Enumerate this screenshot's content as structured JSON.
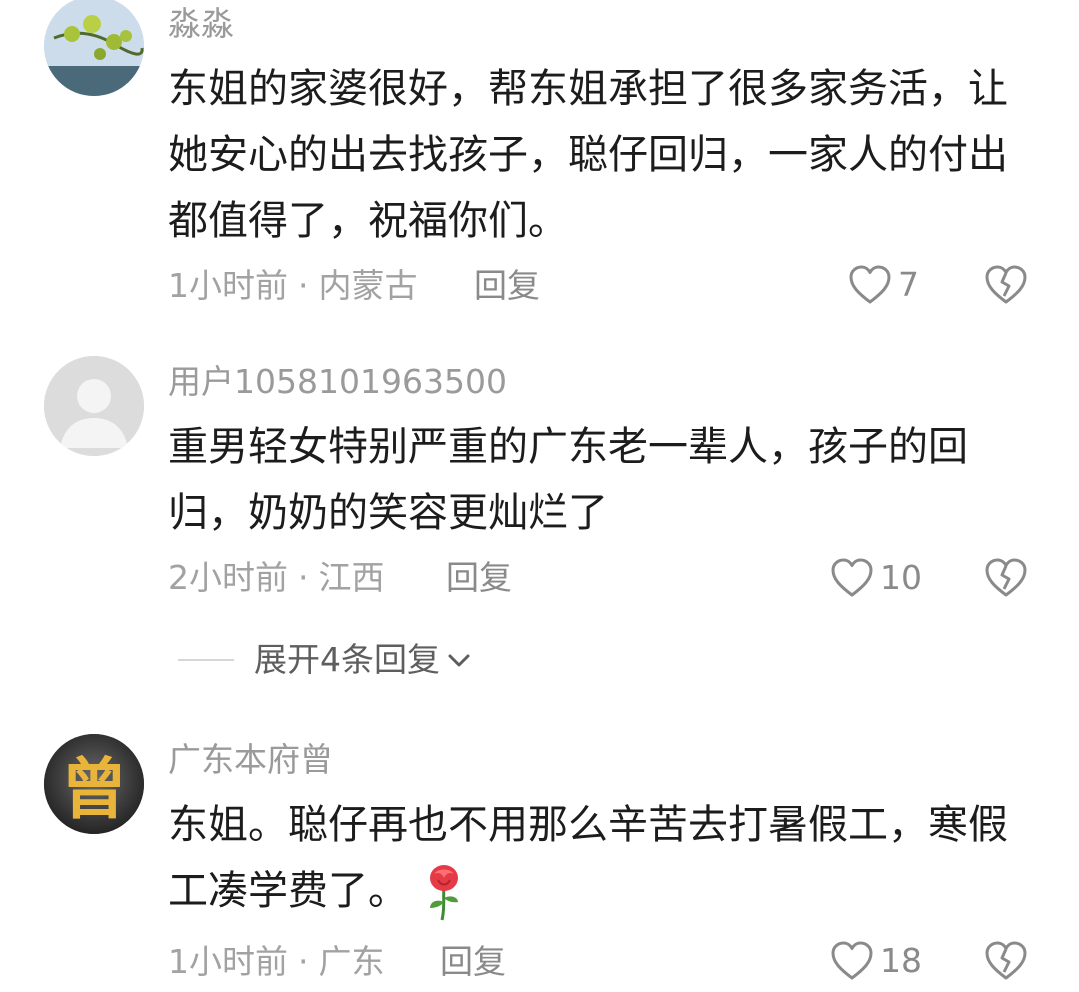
{
  "comments": [
    {
      "username": "淼淼",
      "lines": [
        "东姐的家婆很好，帮东姐承担了很多家务活，让",
        "她安心的出去找孩子，聪仔回归，一家人的付出",
        "都值得了，祝福你们。"
      ],
      "time": "1小时前",
      "separator": "·",
      "location": "内蒙古",
      "reply_label": "回复",
      "likes": "7"
    },
    {
      "username": "用户1058101963500",
      "lines": [
        "重男轻女特别严重的广东老一辈人，孩子的回",
        "归，奶奶的笑容更灿烂了"
      ],
      "time": "2小时前",
      "separator": "·",
      "location": "江西",
      "reply_label": "回复",
      "likes": "10",
      "expand_label": "展开4条回复"
    },
    {
      "username": "广东本府曾",
      "lines": [
        "东姐。聪仔再也不用那么辛苦去打暑假工，寒假",
        "工凑学费了。"
      ],
      "emoji": "rose-emoji",
      "avatar_char": "曾",
      "time": "1小时前",
      "separator": "·",
      "location": "广东",
      "reply_label": "回复",
      "likes": "18"
    }
  ],
  "colors": {
    "text": "#1c1c1c",
    "secondary": "#9a9a9a",
    "icon": "#8a8a8a"
  },
  "icons": [
    "heart-icon",
    "broken-heart-icon",
    "chevron-down-icon",
    "default-avatar-icon",
    "rose-emoji"
  ]
}
